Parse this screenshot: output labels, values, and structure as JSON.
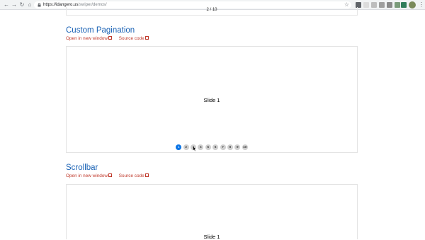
{
  "browser": {
    "url_host": "https://idangero.us",
    "url_path": "/swiper/demos/"
  },
  "prev_demo": {
    "counter": "2 / 10"
  },
  "custom_pagination": {
    "title": "Custom Pagination",
    "open_label": "Open in new window",
    "source_label": "Source code",
    "slide_text": "Slide 1",
    "bullets": [
      "1",
      "2",
      "3",
      "4",
      "5",
      "6",
      "7",
      "8",
      "9",
      "10"
    ],
    "active_index": 0
  },
  "scrollbar": {
    "title": "Scrollbar",
    "open_label": "Open in new window",
    "source_label": "Source code",
    "slide_text": "Slide 1"
  },
  "colors": {
    "title": "#1a62b5",
    "link": "#c0392b",
    "active_bullet": "#0a74e6"
  }
}
